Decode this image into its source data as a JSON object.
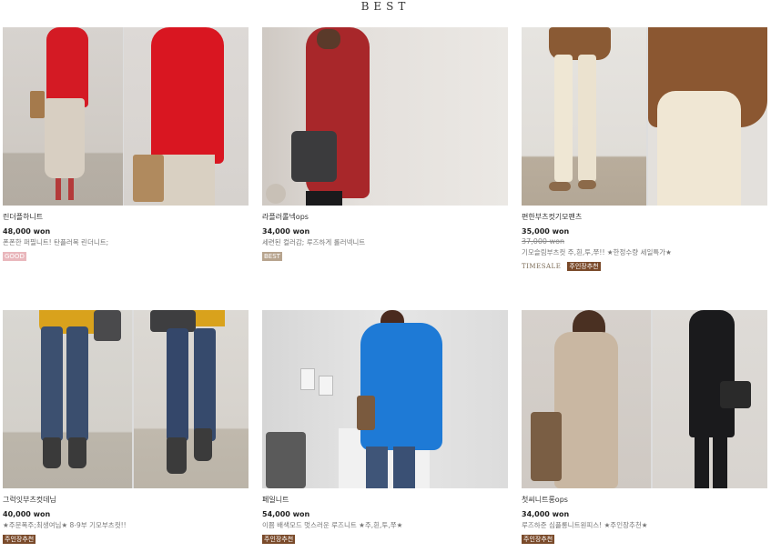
{
  "section": {
    "title": "BEST"
  },
  "products": [
    {
      "name": "린더플하니트",
      "price": "48,000 won",
      "old_price": "",
      "desc": "폰폰한 퍼필니트! 탄플러복 린더니트;",
      "badges": [
        {
          "text": "GOOD",
          "kind": "good"
        }
      ]
    },
    {
      "name": "라플러롤넥ops",
      "price": "34,000 won",
      "old_price": "",
      "desc": "세련된 컬러감; 루즈하게 롤러넥니트",
      "badges": [
        {
          "text": "BEST",
          "kind": "best"
        }
      ]
    },
    {
      "name": "편한부츠컷기모팬츠",
      "price": "35,000 won",
      "old_price": "37,000 won",
      "desc": "기모슬림부츠컷 주,흰,투,쭈!! ★한정수량 세일특가★",
      "badges": [
        {
          "text": "TIMESALE",
          "kind": "time"
        },
        {
          "text": "주인장추천",
          "kind": "pick"
        }
      ]
    },
    {
      "name": "그럭잇부츠컷데님",
      "price": "40,000 won",
      "old_price": "",
      "desc": "★주문폭주;최생여님★ 8-9부 기모부츠컷!!",
      "badges": [
        {
          "text": "주인장추천",
          "kind": "pick"
        }
      ]
    },
    {
      "name": "페일니트",
      "price": "54,000 won",
      "old_price": "",
      "desc": "이쁨 배색모드 멋스러운 루즈니트 ★주,흰,투,쭈★",
      "badges": [
        {
          "text": "주인장추천",
          "kind": "pick"
        }
      ]
    },
    {
      "name": "첫씨니트롱ops",
      "price": "34,000 won",
      "old_price": "",
      "desc": "루즈하준 심플롱니트원피스! ★주인장추천★",
      "badges": [
        {
          "text": "주인장추천",
          "kind": "pick"
        }
      ]
    }
  ]
}
